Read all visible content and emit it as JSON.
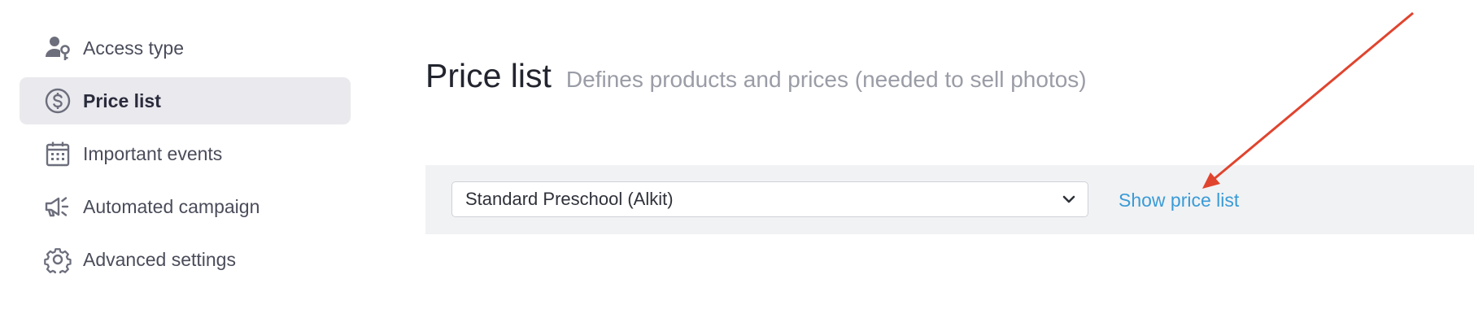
{
  "sidebar": {
    "items": [
      {
        "label": "Access type",
        "icon": "user-key-icon",
        "active": false
      },
      {
        "label": "Price list",
        "icon": "dollar-circle-icon",
        "active": true
      },
      {
        "label": "Important events",
        "icon": "calendar-icon",
        "active": false
      },
      {
        "label": "Automated campaign",
        "icon": "megaphone-icon",
        "active": false
      },
      {
        "label": "Advanced settings",
        "icon": "gear-icon",
        "active": false
      }
    ]
  },
  "header": {
    "title": "Price list",
    "subtitle": "Defines products and prices (needed to sell photos)"
  },
  "price_selector": {
    "selected_value": "Standard Preschool (Alkit)",
    "link_label": "Show price list"
  },
  "colors": {
    "accent_link": "#3a9bd6",
    "active_item_bg": "#e9e9ee",
    "annotation_arrow": "#e0442e"
  }
}
